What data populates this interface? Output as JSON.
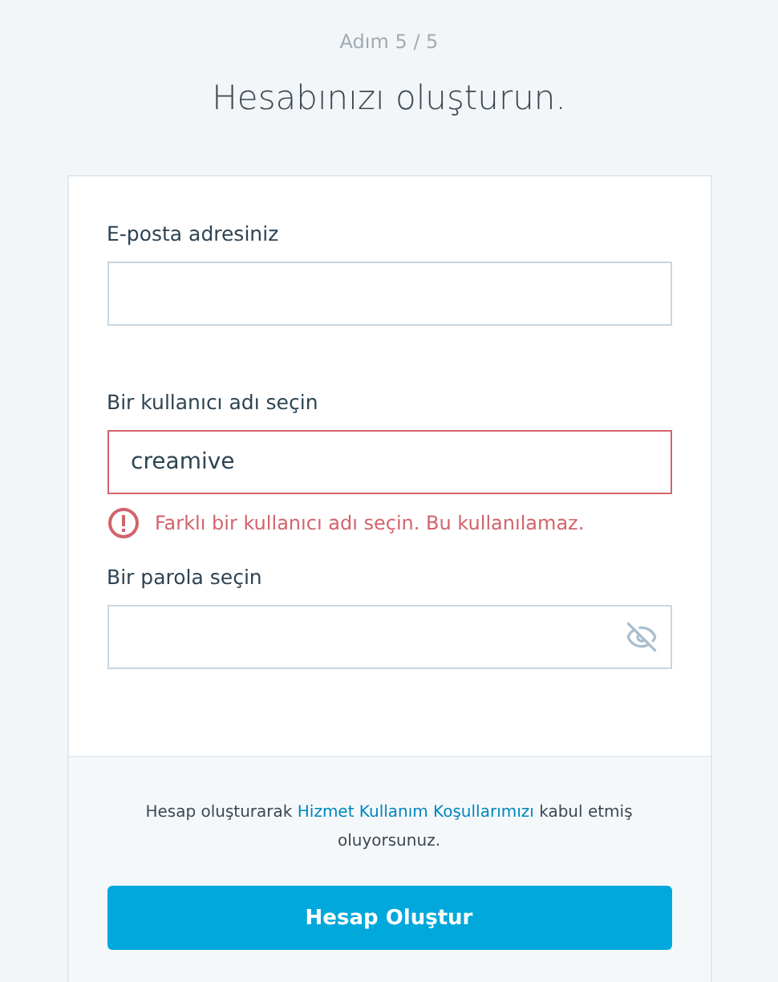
{
  "step": "Adım 5 / 5",
  "title": "Hesabınızı oluşturun.",
  "fields": [
    {
      "kind": "text",
      "label": "E-posta adresiniz",
      "invalid": false
    },
    {
      "kind": "text",
      "label": "Bir kullanıcı adı seçin",
      "value": "creamive",
      "invalid": true,
      "error": "Farklı bir kullanıcı adı seçin. Bu kullanılamaz."
    },
    {
      "kind": "password",
      "label": "Bir parola seçin",
      "invalid": false
    }
  ],
  "terms": {
    "before": "Hesap oluşturarak",
    "link": "Hizmet Kullanım Koşullarımızı",
    "after": "kabul etmiş oluyorsunuz."
  },
  "submit": "Hesap Oluştur"
}
